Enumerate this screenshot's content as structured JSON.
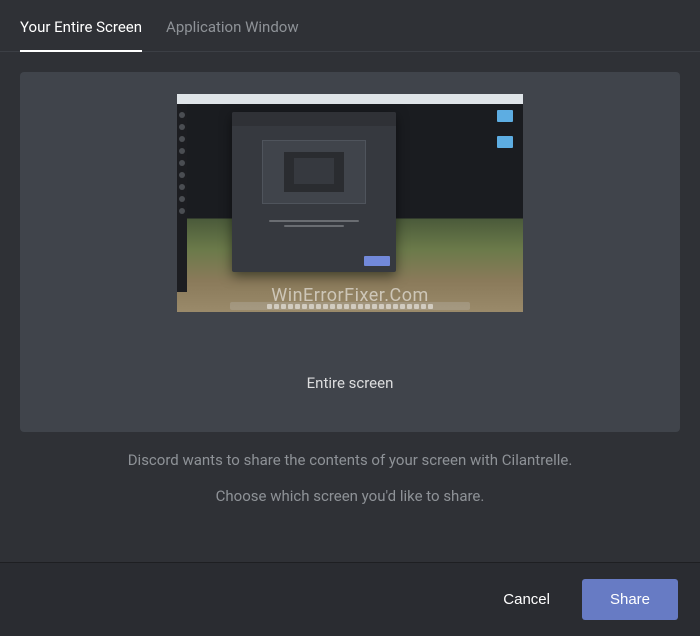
{
  "tabs": {
    "entireScreen": "Your Entire Screen",
    "appWindow": "Application Window"
  },
  "screenOption": {
    "label": "Entire screen",
    "watermark": "WinErrorFixer.Com"
  },
  "description": {
    "line1": "Discord wants to share the contents of your screen with Cilantrelle.",
    "line2": "Choose which screen you'd like to share."
  },
  "buttons": {
    "cancel": "Cancel",
    "share": "Share"
  }
}
